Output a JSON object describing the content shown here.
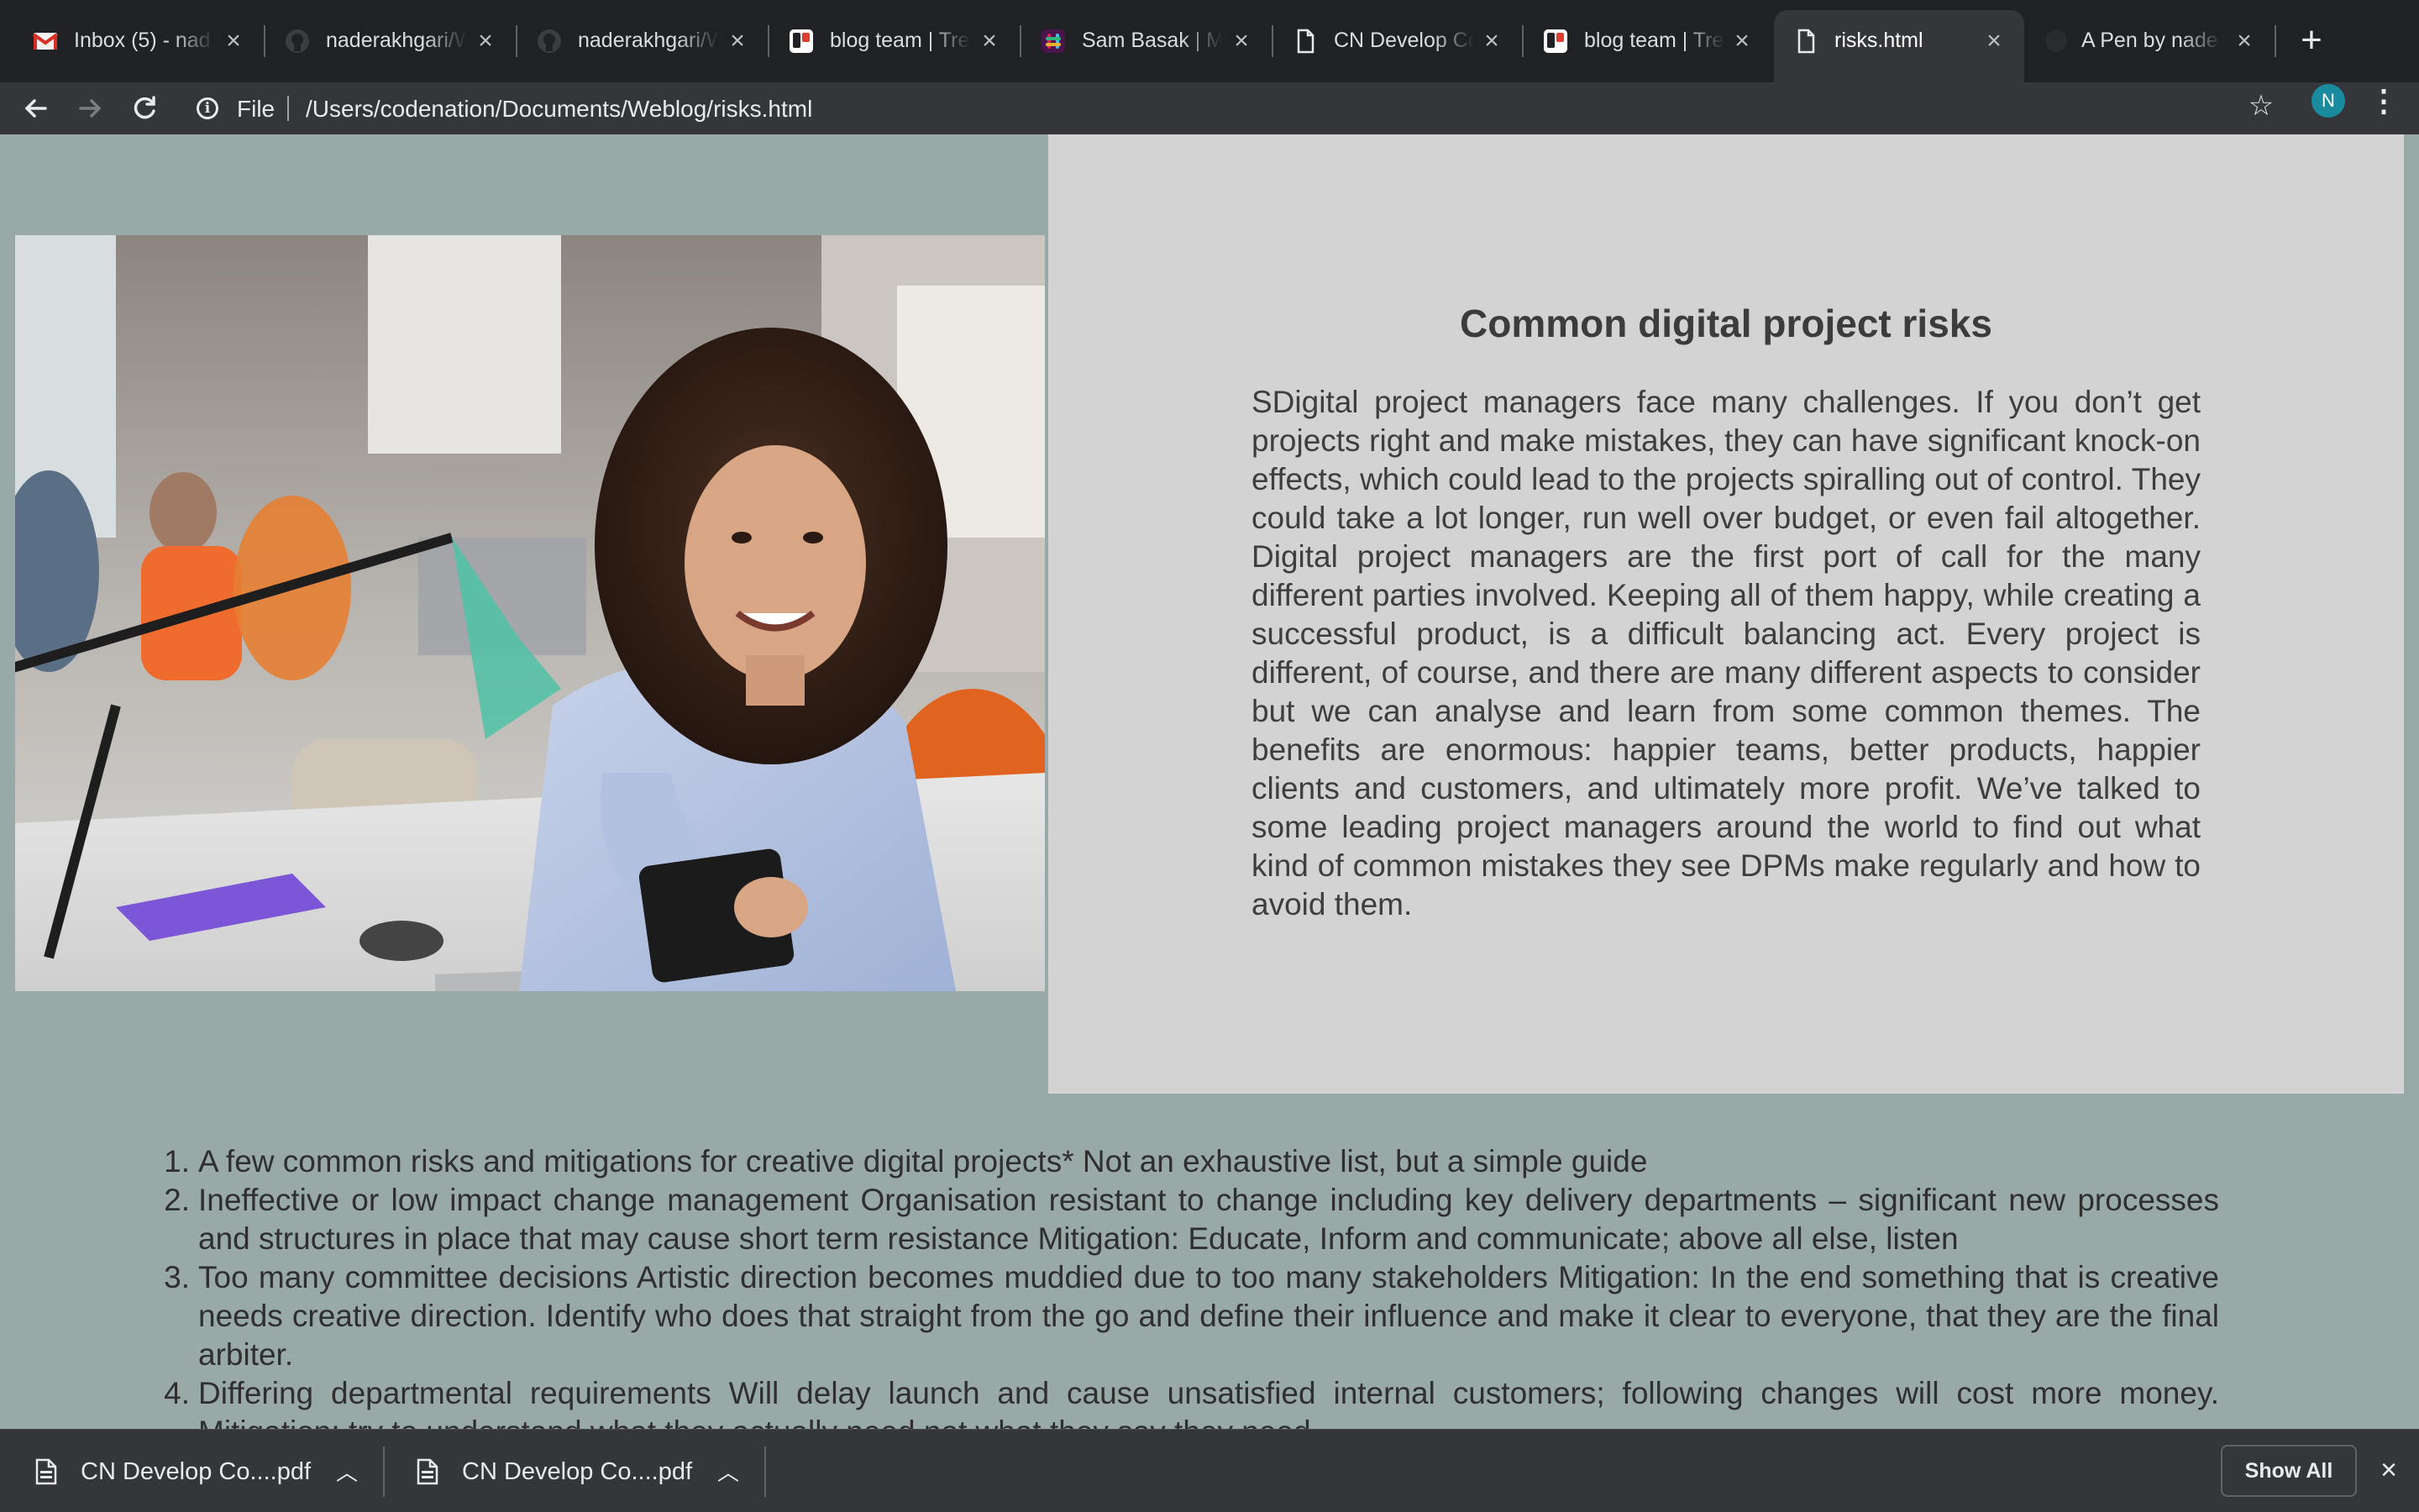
{
  "tabs": [
    {
      "label": "Inbox (5) - nad",
      "favicon": "gmail-icon"
    },
    {
      "label": "naderakhgari/W",
      "favicon": "github-icon"
    },
    {
      "label": "naderakhgari/W",
      "favicon": "github-icon"
    },
    {
      "label": "blog team | Tre",
      "favicon": "trello-icon"
    },
    {
      "label": "Sam Basak | M",
      "favicon": "slack-icon"
    },
    {
      "label": "CN Develop Co",
      "favicon": "document-icon"
    },
    {
      "label": "blog team | Tre",
      "favicon": "trello-icon"
    },
    {
      "label": "risks.html",
      "favicon": "document-icon",
      "active": true
    },
    {
      "label": "A Pen by nade",
      "favicon": "codepen-icon"
    }
  ],
  "toolbar": {
    "scheme": "File",
    "url": "/Users/codenation/Documents/Weblog/risks.html",
    "avatar_initial": "N"
  },
  "page": {
    "heading": "Common digital project risks",
    "intro": "SDigital project managers face many challenges. If you don’t get projects right and make mistakes, they can have significant knock-on effects, which could lead to the projects spiralling out of control. They could take a lot longer, run well over budget, or even fail altogether. Digital project managers are the first port of call for the many different parties involved. Keeping all of them happy, while creating a successful product, is a difficult balancing act. Every project is different, of course, and there are many different aspects to consider but we can analyse and learn from some common themes. The benefits are enormous: happier teams, better products, happier clients and customers, and ultimately more profit. We’ve talked to some leading project managers around the world to find out what kind of common mistakes they see DPMs make regularly and how to avoid them.",
    "list": [
      {
        "num": "1.",
        "text": "A few common risks and mitigations for creative digital projects* Not an exhaustive list, but a simple guide"
      },
      {
        "num": "2.",
        "text": "Ineffective or low impact change management Organisation resistant to change including key delivery departments – significant new processes and structures in place that may cause short term resistance Mitigation: Educate, Inform and communicate; above all else, listen"
      },
      {
        "num": "3.",
        "text": "Too many committee decisions Artistic direction becomes muddied due to too many stakeholders Mitigation: In the end something that is creative needs creative direction. Identify who does that straight from the go and define their influence and make it clear to everyone, that they are the final arbiter."
      },
      {
        "num": "4.",
        "text": "Differing departmental requirements Will delay launch and cause unsatisfied internal customers; following changes will cost more money. Mitigation: try to understand what they actually need not what they say they need"
      }
    ]
  },
  "downloads": {
    "items": [
      {
        "name": "CN Develop Co....pdf"
      },
      {
        "name": "CN Develop Co....pdf"
      }
    ],
    "show_all": "Show All"
  }
}
